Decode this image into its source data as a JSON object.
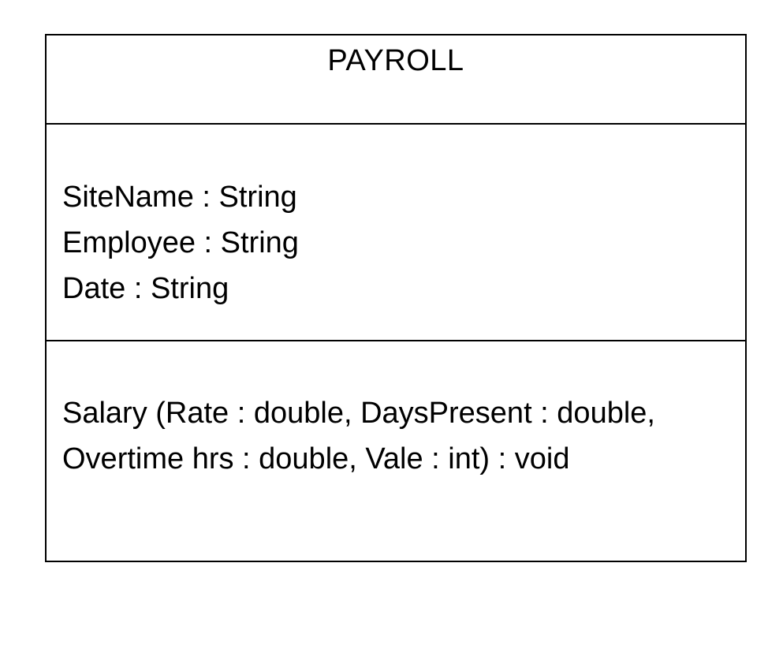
{
  "class": {
    "name": "PAYROLL",
    "attributes": [
      "SiteName : String",
      "Employee : String",
      "Date : String"
    ],
    "operations": [
      "Salary (Rate : double, DaysPresent : double,",
      "Overtime hrs : double, Vale : int) : void"
    ]
  }
}
